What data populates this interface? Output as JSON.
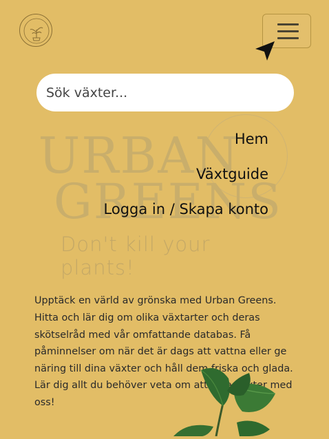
{
  "header": {
    "logo_icon": "plant-logo-icon",
    "menu_icon": "hamburger-menu-icon"
  },
  "search": {
    "placeholder": "Sök växter..."
  },
  "hero": {
    "title_line1": "URBAN",
    "title_line2": "GREENS",
    "tagline": "Don't kill your plants!"
  },
  "nav": {
    "items": [
      {
        "label": "Hem"
      },
      {
        "label": "Växtguide"
      },
      {
        "label": "Logga in / Skapa konto"
      }
    ]
  },
  "main": {
    "description": "Upptäck en värld av grönska med Urban Greens. Hitta och lär dig om olika växtarter och deras skötselråd med vår omfattande databas. Få påminnelser om när det är dags att vattna eller ge näring till dina växter och håll dem friska och glada. Lär dig allt du behöver veta om att odla växter med oss!"
  },
  "colors": {
    "background": "#e2bd66",
    "text": "#222222",
    "leaf": "#2f6b2f"
  }
}
